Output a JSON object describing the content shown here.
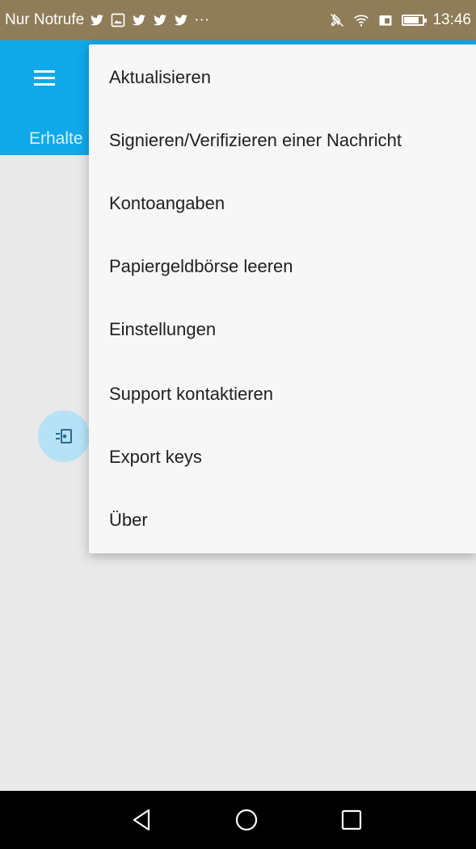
{
  "status_bar": {
    "carrier": "Nur Notrufe",
    "overflow": "···",
    "time": "13:46",
    "battery_level": 0.8,
    "icons": [
      "twitter-icon",
      "image-icon",
      "twitter-icon",
      "twitter-icon",
      "twitter-icon",
      "mute-icon",
      "wifi-icon",
      "sim-icon",
      "battery-icon"
    ]
  },
  "app_bar": {
    "subtitle": "Erhalte",
    "color": "#0fa8e8"
  },
  "menu": {
    "items": [
      {
        "label": "Aktualisieren"
      },
      {
        "label": "Signieren/Verifizieren einer Nachricht"
      },
      {
        "label": "Kontoangaben"
      },
      {
        "label": "Papiergeldbörse leeren"
      },
      {
        "label": "Einstellungen"
      },
      {
        "label": "Support kontaktieren"
      },
      {
        "label": "Export keys"
      },
      {
        "label": "Über"
      }
    ]
  },
  "fab": {
    "icon": "receive-icon"
  },
  "nav": {
    "back": "back-icon",
    "home": "home-icon",
    "recents": "recents-icon"
  }
}
